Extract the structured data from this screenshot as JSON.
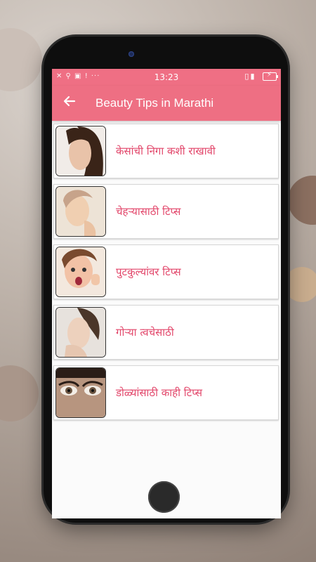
{
  "status_bar": {
    "time": "13:23",
    "left_icons": "✕ ⚲ ▣ ! ···",
    "right_icons": "▯▮"
  },
  "app_bar": {
    "back_icon": "arrow-left-icon",
    "title": "Beauty Tips in Marathi"
  },
  "items": [
    {
      "label": "केसांची निगा कशी राखावी",
      "thumb": "hair-care-photo"
    },
    {
      "label": "चेहऱ्यासाठी टिप्स",
      "thumb": "face-photo"
    },
    {
      "label": "पुटकुल्यांवर टिप्स",
      "thumb": "pimples-photo"
    },
    {
      "label": "गोऱ्या त्वचेसाठी",
      "thumb": "fair-skin-photo"
    },
    {
      "label": "डोळ्यांसाठी काही टिप्स",
      "thumb": "eyes-photo"
    }
  ],
  "colors": {
    "accent": "#ee6f83",
    "label": "#e2466a"
  }
}
